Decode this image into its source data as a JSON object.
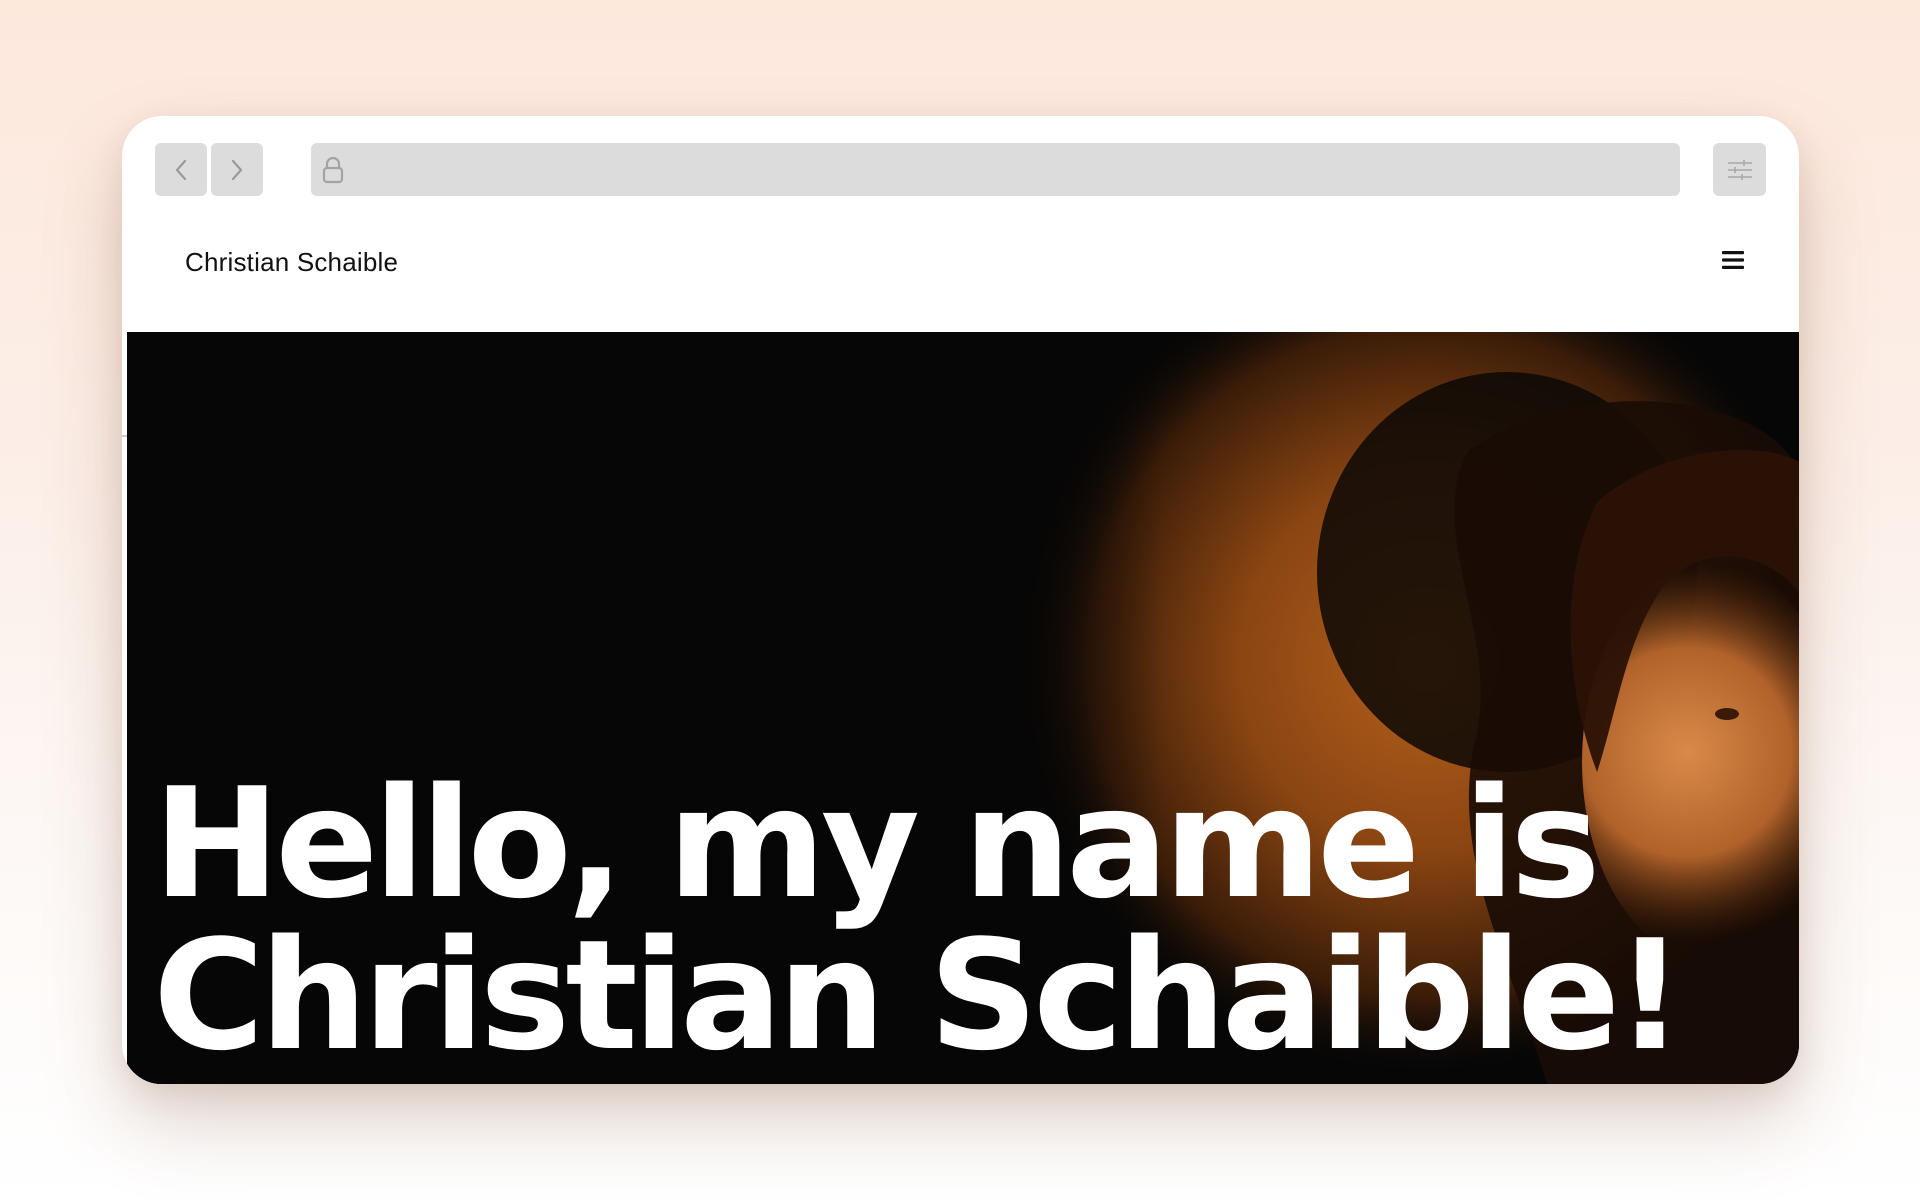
{
  "browser": {
    "back_icon": "chevron-left-icon",
    "forward_icon": "chevron-right-icon",
    "address_icon": "lock-icon",
    "settings_icon": "sliders-icon",
    "chrome_color": "#dcdcdc"
  },
  "site": {
    "title": "Christian Schaible",
    "menu_icon": "hamburger-menu-icon"
  },
  "hero": {
    "headline_line1": "Hello, my name is",
    "headline_line2": "Christian Schaible!",
    "background_color": "#060606",
    "accent_color": "#c9671d"
  }
}
